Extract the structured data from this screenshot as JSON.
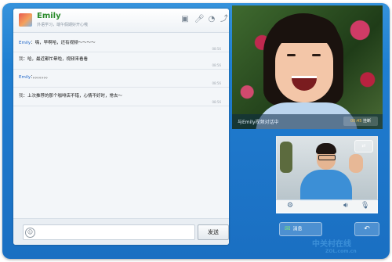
{
  "contact": {
    "name": "Emily",
    "status": "外语学习，端午假期好开心哦"
  },
  "header_icons": [
    "image-icon",
    "microphone-icon",
    "clock-icon",
    "share-icon"
  ],
  "messages": [
    {
      "sender": "Emily",
      "separator": "：",
      "text": "嗨，早啊哈，还有视频～～～～",
      "time": "08:56"
    },
    {
      "sender": "我",
      "separator": "：",
      "text": "哈，最近都忙晕啦，视频来看看",
      "time": "08:56"
    },
    {
      "sender": "Emily",
      "separator": "：",
      "text": "。。。。。。。",
      "time": "08:56"
    },
    {
      "sender": "我",
      "separator": "：",
      "text": "上次推荐的那个咖啡店不错，心情不好时，常去～",
      "time": "08:56"
    }
  ],
  "input": {
    "send_label": "发送"
  },
  "video": {
    "call_text": "与Emily视频对话中",
    "timer": "00:45",
    "end_label": "挂断"
  },
  "bottom": {
    "message_label": "消息",
    "back_icon": "back-arrow-icon"
  },
  "watermark": {
    "brand": "中关村在线",
    "domain": "ZOL.com.cn"
  },
  "colors": {
    "accent": "#1e86d8",
    "sender_blue": "#1c64c8",
    "contact_green": "#2a8b2a"
  }
}
